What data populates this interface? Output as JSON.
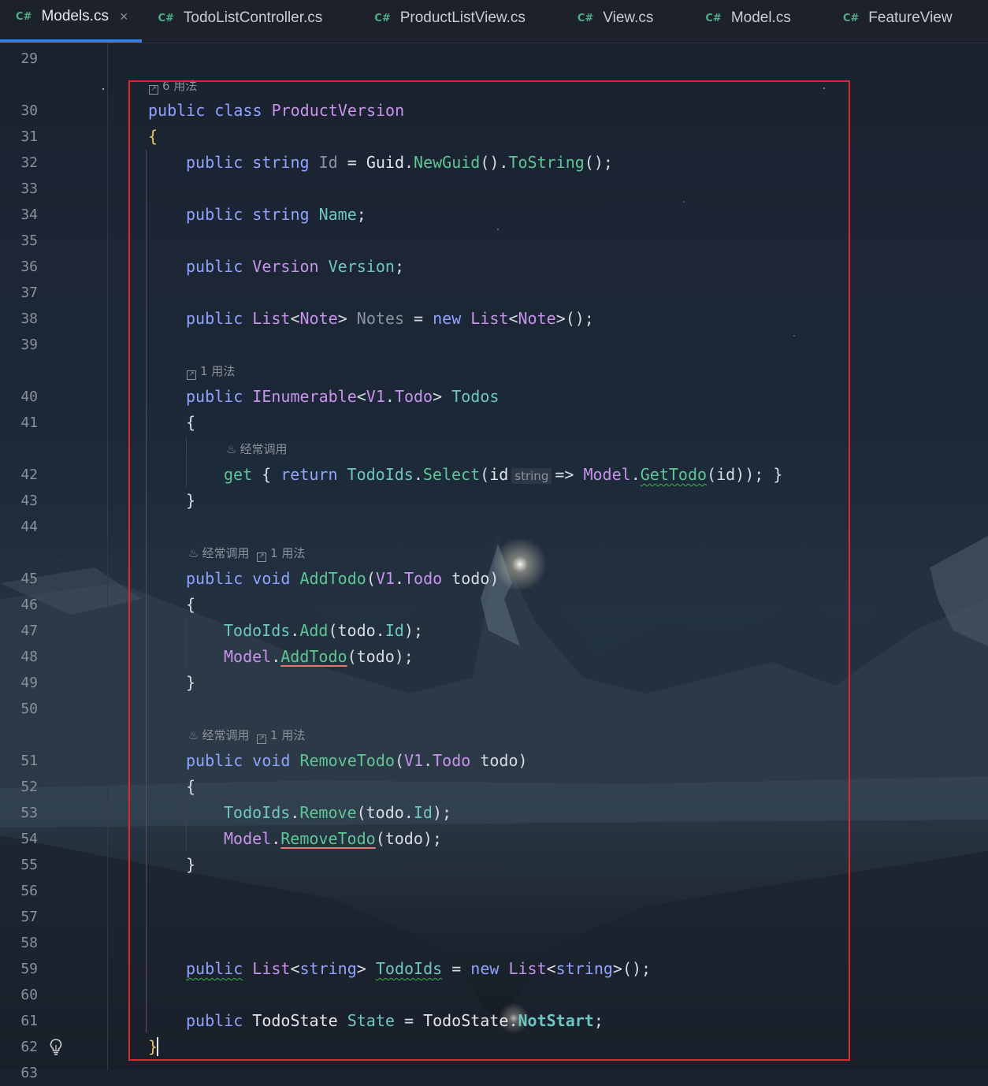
{
  "tabs": [
    {
      "lang": "C#",
      "label": "Models.cs",
      "active": true,
      "close": "×"
    },
    {
      "lang": "C#",
      "label": "TodoListController.cs"
    },
    {
      "lang": "C#",
      "label": "ProductListView.cs"
    },
    {
      "lang": "C#",
      "label": "View.cs"
    },
    {
      "lang": "C#",
      "label": "Model.cs"
    },
    {
      "lang": "C#",
      "label": "FeatureView"
    }
  ],
  "hints": {
    "class_usages": "6 用法",
    "usage_1": "1 用法",
    "frequent": "经常调用",
    "param_type": "string"
  },
  "line_numbers": [
    "29",
    "30",
    "31",
    "32",
    "33",
    "34",
    "35",
    "36",
    "37",
    "38",
    "39",
    "40",
    "41",
    "42",
    "43",
    "44",
    "45",
    "46",
    "47",
    "48",
    "49",
    "50",
    "51",
    "52",
    "53",
    "54",
    "55",
    "56",
    "57",
    "58",
    "59",
    "60",
    "61",
    "62",
    "63"
  ],
  "colors": {
    "keyword": "#8fa3ff",
    "type": "#c792ea",
    "field": "#6dc6c2",
    "method": "#5fc595",
    "selection_border": "#e0262e",
    "active_tab_underline": "#3d7de0"
  },
  "icons": {
    "lightbulb": "lightbulb-icon",
    "usages": "usages-icon",
    "frequent_call": "flame-icon"
  }
}
